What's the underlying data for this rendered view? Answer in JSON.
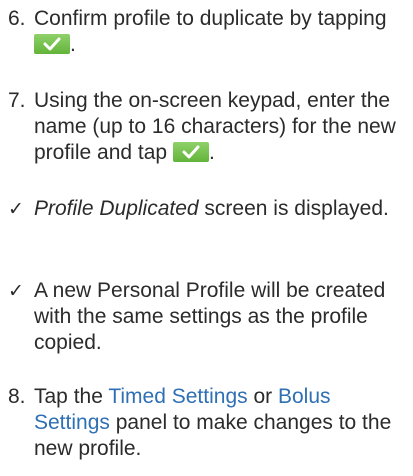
{
  "steps": [
    {
      "marker": "6.",
      "text_before": "Confirm profile to duplicate by tapping",
      "text_after": "."
    },
    {
      "marker": "7.",
      "text_before": "Using the on-screen keypad, enter the name (up to 16 characters) for the new profile and tap",
      "text_after": "."
    },
    {
      "marker": "✓",
      "italic": "Profile Duplicated",
      "text_after": " screen is displayed."
    },
    {
      "marker": "✓",
      "text": "A new Personal Profile will be created with the same settings as the profile copied."
    },
    {
      "marker": "8.",
      "text_before": "Tap the ",
      "highlight1": "Timed Settings",
      "middle": " or ",
      "highlight2": "Bolus Settings",
      "text_after": " panel to make changes to the new profile."
    }
  ],
  "icons": {
    "confirm": "checkmark-button-icon"
  },
  "colors": {
    "confirm_button": "#6fbf45",
    "text": "#2b2b2b"
  }
}
